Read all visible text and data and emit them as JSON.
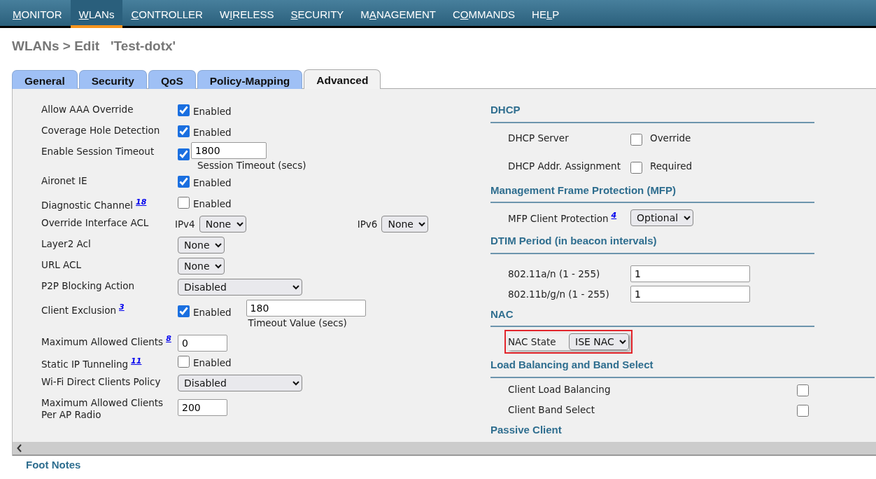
{
  "menu": [
    {
      "segments": [
        {
          "text": "M",
          "underlined": true
        },
        {
          "text": "ONITOR",
          "underlined": false
        }
      ],
      "selected": false
    },
    {
      "segments": [
        {
          "text": "W",
          "underlined": true
        },
        {
          "text": "LANs",
          "underlined": false
        }
      ],
      "selected": true
    },
    {
      "segments": [
        {
          "text": "C",
          "underlined": true
        },
        {
          "text": "ONTROLLER",
          "underlined": false
        }
      ],
      "selected": false
    },
    {
      "segments": [
        {
          "text": "W",
          "underlined": false
        },
        {
          "text": "I",
          "underlined": true
        },
        {
          "text": "RELESS",
          "underlined": false
        }
      ],
      "selected": false
    },
    {
      "segments": [
        {
          "text": "S",
          "underlined": true
        },
        {
          "text": "ECURITY",
          "underlined": false
        }
      ],
      "selected": false
    },
    {
      "segments": [
        {
          "text": "M",
          "underlined": false
        },
        {
          "text": "A",
          "underlined": true
        },
        {
          "text": "NAGEMENT",
          "underlined": false
        }
      ],
      "selected": false
    },
    {
      "segments": [
        {
          "text": "C",
          "underlined": false
        },
        {
          "text": "O",
          "underlined": true
        },
        {
          "text": "MMANDS",
          "underlined": false
        }
      ],
      "selected": false
    },
    {
      "segments": [
        {
          "text": "HE",
          "underlined": false
        },
        {
          "text": "L",
          "underlined": true
        },
        {
          "text": "P",
          "underlined": false
        }
      ],
      "selected": false
    }
  ],
  "page_title": "WLANs > Edit   'Test-dotx'",
  "tabs": [
    {
      "label": "General",
      "selected": false
    },
    {
      "label": "Security",
      "selected": false
    },
    {
      "label": "QoS",
      "selected": false
    },
    {
      "label": "Policy-Mapping",
      "selected": false
    },
    {
      "label": "Advanced",
      "selected": true
    }
  ],
  "left_rows": [
    {
      "kind": "check",
      "label": "Allow AAA Override",
      "checked": true,
      "text": "Enabled"
    },
    {
      "kind": "check",
      "label": "Coverage Hole Detection",
      "checked": true,
      "text": "Enabled"
    },
    {
      "kind": "check_input",
      "label": "Enable Session Timeout",
      "checked": true,
      "value": "1800",
      "caption": "Session Timeout (secs)"
    },
    {
      "kind": "check",
      "label": "Aironet IE",
      "checked": true,
      "text": "Enabled"
    },
    {
      "kind": "check",
      "label": "Diagnostic Channel",
      "note": "18",
      "checked": false,
      "text": "Enabled"
    },
    {
      "kind": "dual_select",
      "label": "Override Interface ACL",
      "selects": [
        {
          "prefix": "IPv4",
          "value": "None"
        },
        {
          "prefix": "IPv6",
          "value": "None"
        }
      ]
    },
    {
      "kind": "select",
      "label": "Layer2 Acl",
      "value": "None"
    },
    {
      "kind": "select",
      "label": "URL ACL",
      "value": "None"
    },
    {
      "kind": "wide_select",
      "label": "P2P Blocking Action",
      "value": "Disabled"
    },
    {
      "kind": "check_side_input",
      "label": "Client Exclusion",
      "note": "3",
      "checked": true,
      "text": "Enabled",
      "value": "180",
      "caption": "Timeout Value (secs)"
    },
    {
      "kind": "input",
      "label": "Maximum Allowed Clients",
      "note": "8",
      "value": "0"
    },
    {
      "kind": "check",
      "label": "Static IP Tunneling",
      "note": "11",
      "checked": false,
      "text": "Enabled"
    },
    {
      "kind": "wide_select",
      "label": "Wi-Fi Direct Clients Policy",
      "value": "Disabled"
    },
    {
      "kind": "input",
      "label": "Maximum Allowed Clients Per AP Radio",
      "value": "200"
    }
  ],
  "right_sections": [
    {
      "title": "DHCP",
      "rows": [
        {
          "kind": "check",
          "label": "DHCP Server",
          "checked": false,
          "text": "Override"
        },
        {
          "kind": "check",
          "label": "DHCP Addr. Assignment",
          "checked": false,
          "text": "Required"
        }
      ]
    },
    {
      "title": "Management Frame Protection (MFP)",
      "rows": [
        {
          "kind": "select",
          "label": "MFP Client Protection",
          "note": "4",
          "value": "Optional"
        }
      ]
    },
    {
      "title": "DTIM Period (in beacon intervals)",
      "rows": [
        {
          "kind": "input",
          "label": "802.11a/n (1 - 255)",
          "value": "1"
        },
        {
          "kind": "input",
          "label": "802.11b/g/n (1 - 255)",
          "value": "1"
        }
      ]
    },
    {
      "title": "NAC",
      "rows": [
        {
          "kind": "select",
          "label": "NAC State",
          "value": "ISE NAC",
          "highlighted": true
        }
      ]
    },
    {
      "title": "Load Balancing and Band Select",
      "rows": [
        {
          "kind": "far_check",
          "label": "Client Load Balancing",
          "checked": false
        },
        {
          "kind": "far_check",
          "label": "Client Band Select",
          "checked": false
        }
      ]
    },
    {
      "title": "Passive Client"
    }
  ],
  "footer_title": "Foot Notes"
}
